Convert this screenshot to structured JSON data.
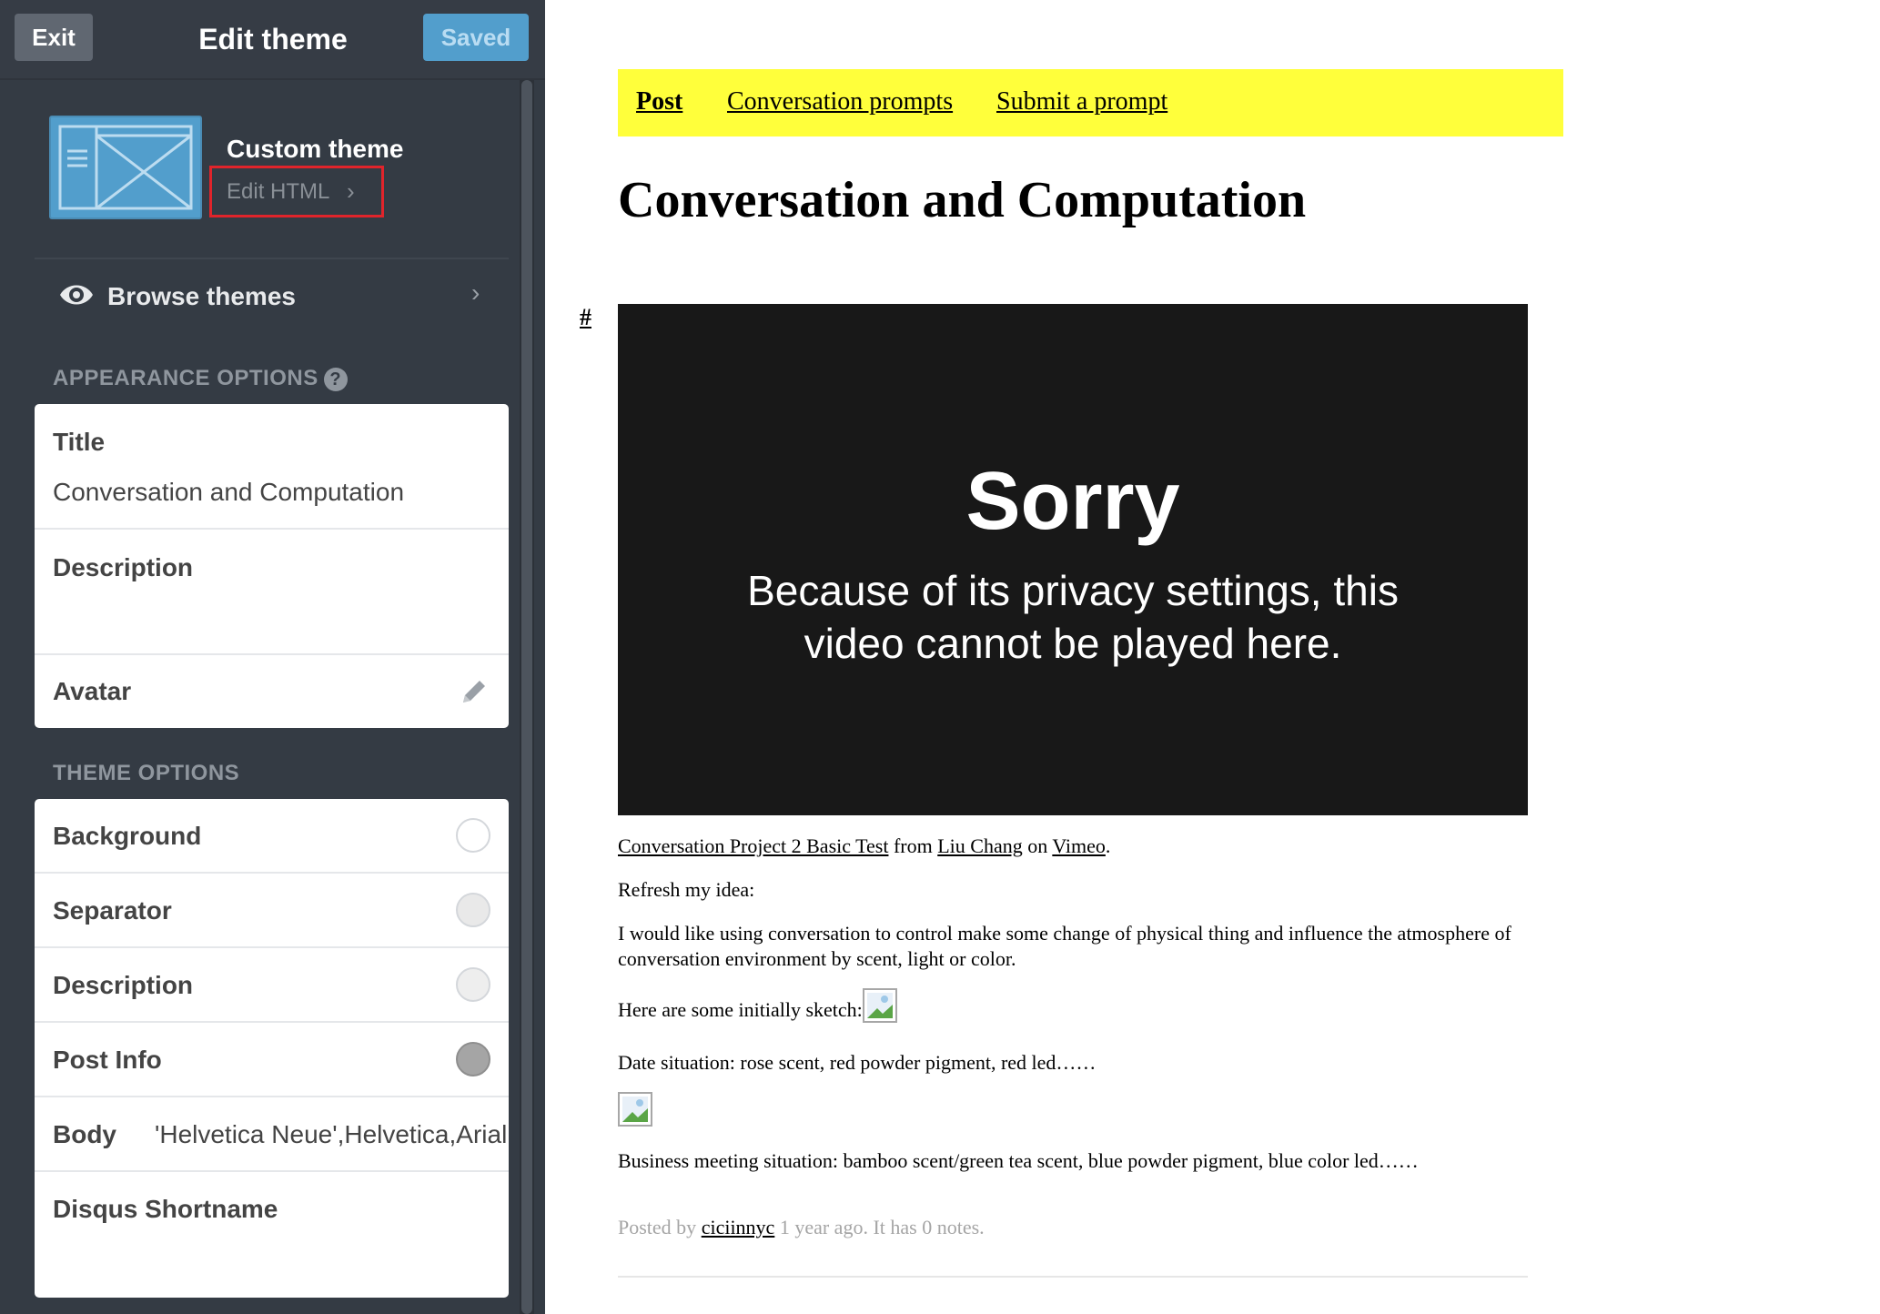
{
  "topbar": {
    "exit_label": "Exit",
    "title": "Edit theme",
    "saved_label": "Saved"
  },
  "theme": {
    "name": "Custom theme",
    "edit_html_label": "Edit HTML",
    "edit_html_chevron": "›"
  },
  "browse": {
    "label": "Browse themes",
    "chevron": "›"
  },
  "appearance": {
    "header": "APPEARANCE OPTIONS",
    "help": "?",
    "title_label": "Title",
    "title_value": "Conversation and Computation",
    "description_label": "Description",
    "avatar_label": "Avatar"
  },
  "theme_options": {
    "header": "THEME OPTIONS",
    "rows": [
      {
        "label": "Background",
        "color": "#ffffff"
      },
      {
        "label": "Separator",
        "color": "#e9e9e9"
      },
      {
        "label": "Description",
        "color": "#eeeeee"
      },
      {
        "label": "Post Info",
        "color": "#a5a5a5"
      }
    ],
    "body_label": "Body",
    "body_value": "'Helvetica Neue',Helvetica,Arial",
    "disqus_label": "Disqus Shortname"
  },
  "preview": {
    "nav": [
      "Post",
      "Conversation prompts",
      "Submit a prompt"
    ],
    "nav_bg": "#ffff3b",
    "blog_title": "Conversation and Computation",
    "permalink": "#",
    "video": {
      "title": "Sorry",
      "message": "Because of its privacy settings, this video cannot be played here."
    },
    "credit": {
      "video_title": "Conversation Project 2 Basic Test",
      "from": " from ",
      "author": "Liu Chang",
      "on": " on ",
      "site": "Vimeo",
      "end": "."
    },
    "paragraphs": {
      "refresh": "Refresh my idea:",
      "idea": "I would like using conversation to control make some change of physical thing and influence the atmosphere of conversation environment by scent, light or color.",
      "sketch": "Here are some initially sketch:",
      "date": "Date situation: rose scent, red powder pigment, red led……",
      "business": "Business meeting situation: bamboo scent/green tea scent, blue powder pigment, blue color led……"
    },
    "post_info": {
      "posted_by": "Posted by ",
      "user": "ciciinnyc",
      "rest": " 1 year ago. It has 0 notes."
    }
  }
}
